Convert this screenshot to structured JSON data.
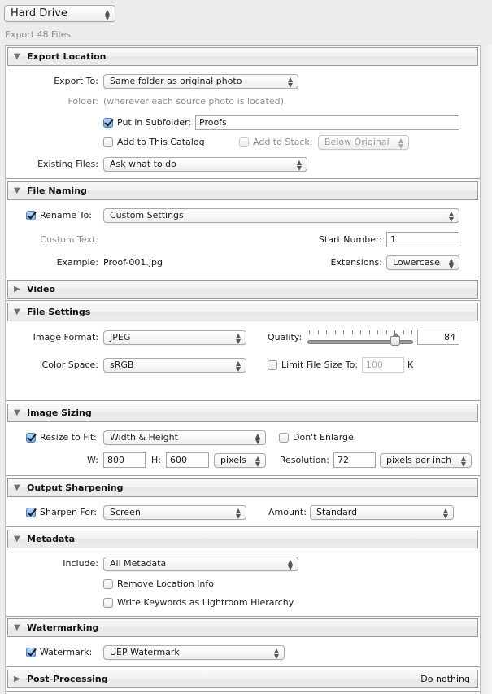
{
  "destination": {
    "selected": "Hard Drive"
  },
  "export_count_label": "Export 48 Files",
  "sections": {
    "export_location": {
      "title": "Export Location",
      "expanded": true,
      "export_to_label": "Export To:",
      "export_to_value": "Same folder as original photo",
      "folder_label": "Folder:",
      "folder_value": "(wherever each source photo is located)",
      "subfolder_label": "Put in Subfolder:",
      "subfolder_checked": true,
      "subfolder_value": "Proofs",
      "add_catalog_label": "Add to This Catalog",
      "add_catalog_checked": false,
      "add_stack_label": "Add to Stack:",
      "add_stack_checked": false,
      "add_stack_value": "Below Original",
      "existing_files_label": "Existing Files:",
      "existing_files_value": "Ask what to do"
    },
    "file_naming": {
      "title": "File Naming",
      "expanded": true,
      "rename_label": "Rename To:",
      "rename_checked": true,
      "rename_value": "Custom Settings",
      "custom_text_label": "Custom Text:",
      "start_number_label": "Start Number:",
      "start_number_value": "1",
      "example_label": "Example:",
      "example_value": "Proof-001.jpg",
      "extensions_label": "Extensions:",
      "extensions_value": "Lowercase"
    },
    "video": {
      "title": "Video",
      "expanded": false
    },
    "file_settings": {
      "title": "File Settings",
      "expanded": true,
      "image_format_label": "Image Format:",
      "image_format_value": "JPEG",
      "quality_label": "Quality:",
      "quality_value": "84",
      "quality_percent": 84,
      "color_space_label": "Color Space:",
      "color_space_value": "sRGB",
      "limit_size_label": "Limit File Size To:",
      "limit_size_checked": false,
      "limit_size_value": "100",
      "limit_size_unit": "K"
    },
    "image_sizing": {
      "title": "Image Sizing",
      "expanded": true,
      "resize_label": "Resize to Fit:",
      "resize_checked": true,
      "resize_value": "Width & Height",
      "dont_enlarge_label": "Don't Enlarge",
      "dont_enlarge_checked": false,
      "w_label": "W:",
      "w_value": "800",
      "h_label": "H:",
      "h_value": "600",
      "units_value": "pixels",
      "resolution_label": "Resolution:",
      "resolution_value": "72",
      "resolution_units_value": "pixels per inch"
    },
    "output_sharpening": {
      "title": "Output Sharpening",
      "expanded": true,
      "sharpen_label": "Sharpen For:",
      "sharpen_checked": true,
      "sharpen_value": "Screen",
      "amount_label": "Amount:",
      "amount_value": "Standard"
    },
    "metadata": {
      "title": "Metadata",
      "expanded": true,
      "include_label": "Include:",
      "include_value": "All Metadata",
      "remove_location_label": "Remove Location Info",
      "remove_location_checked": false,
      "write_keywords_label": "Write Keywords as Lightroom Hierarchy",
      "write_keywords_checked": false
    },
    "watermarking": {
      "title": "Watermarking",
      "expanded": true,
      "watermark_label": "Watermark:",
      "watermark_checked": true,
      "watermark_value": "UEP Watermark"
    },
    "post_processing": {
      "title": "Post-Processing",
      "expanded": false,
      "summary": "Do nothing"
    }
  },
  "icons": {
    "expanded": "▼",
    "collapsed": "▶",
    "popup_arrows": "▲▼"
  }
}
